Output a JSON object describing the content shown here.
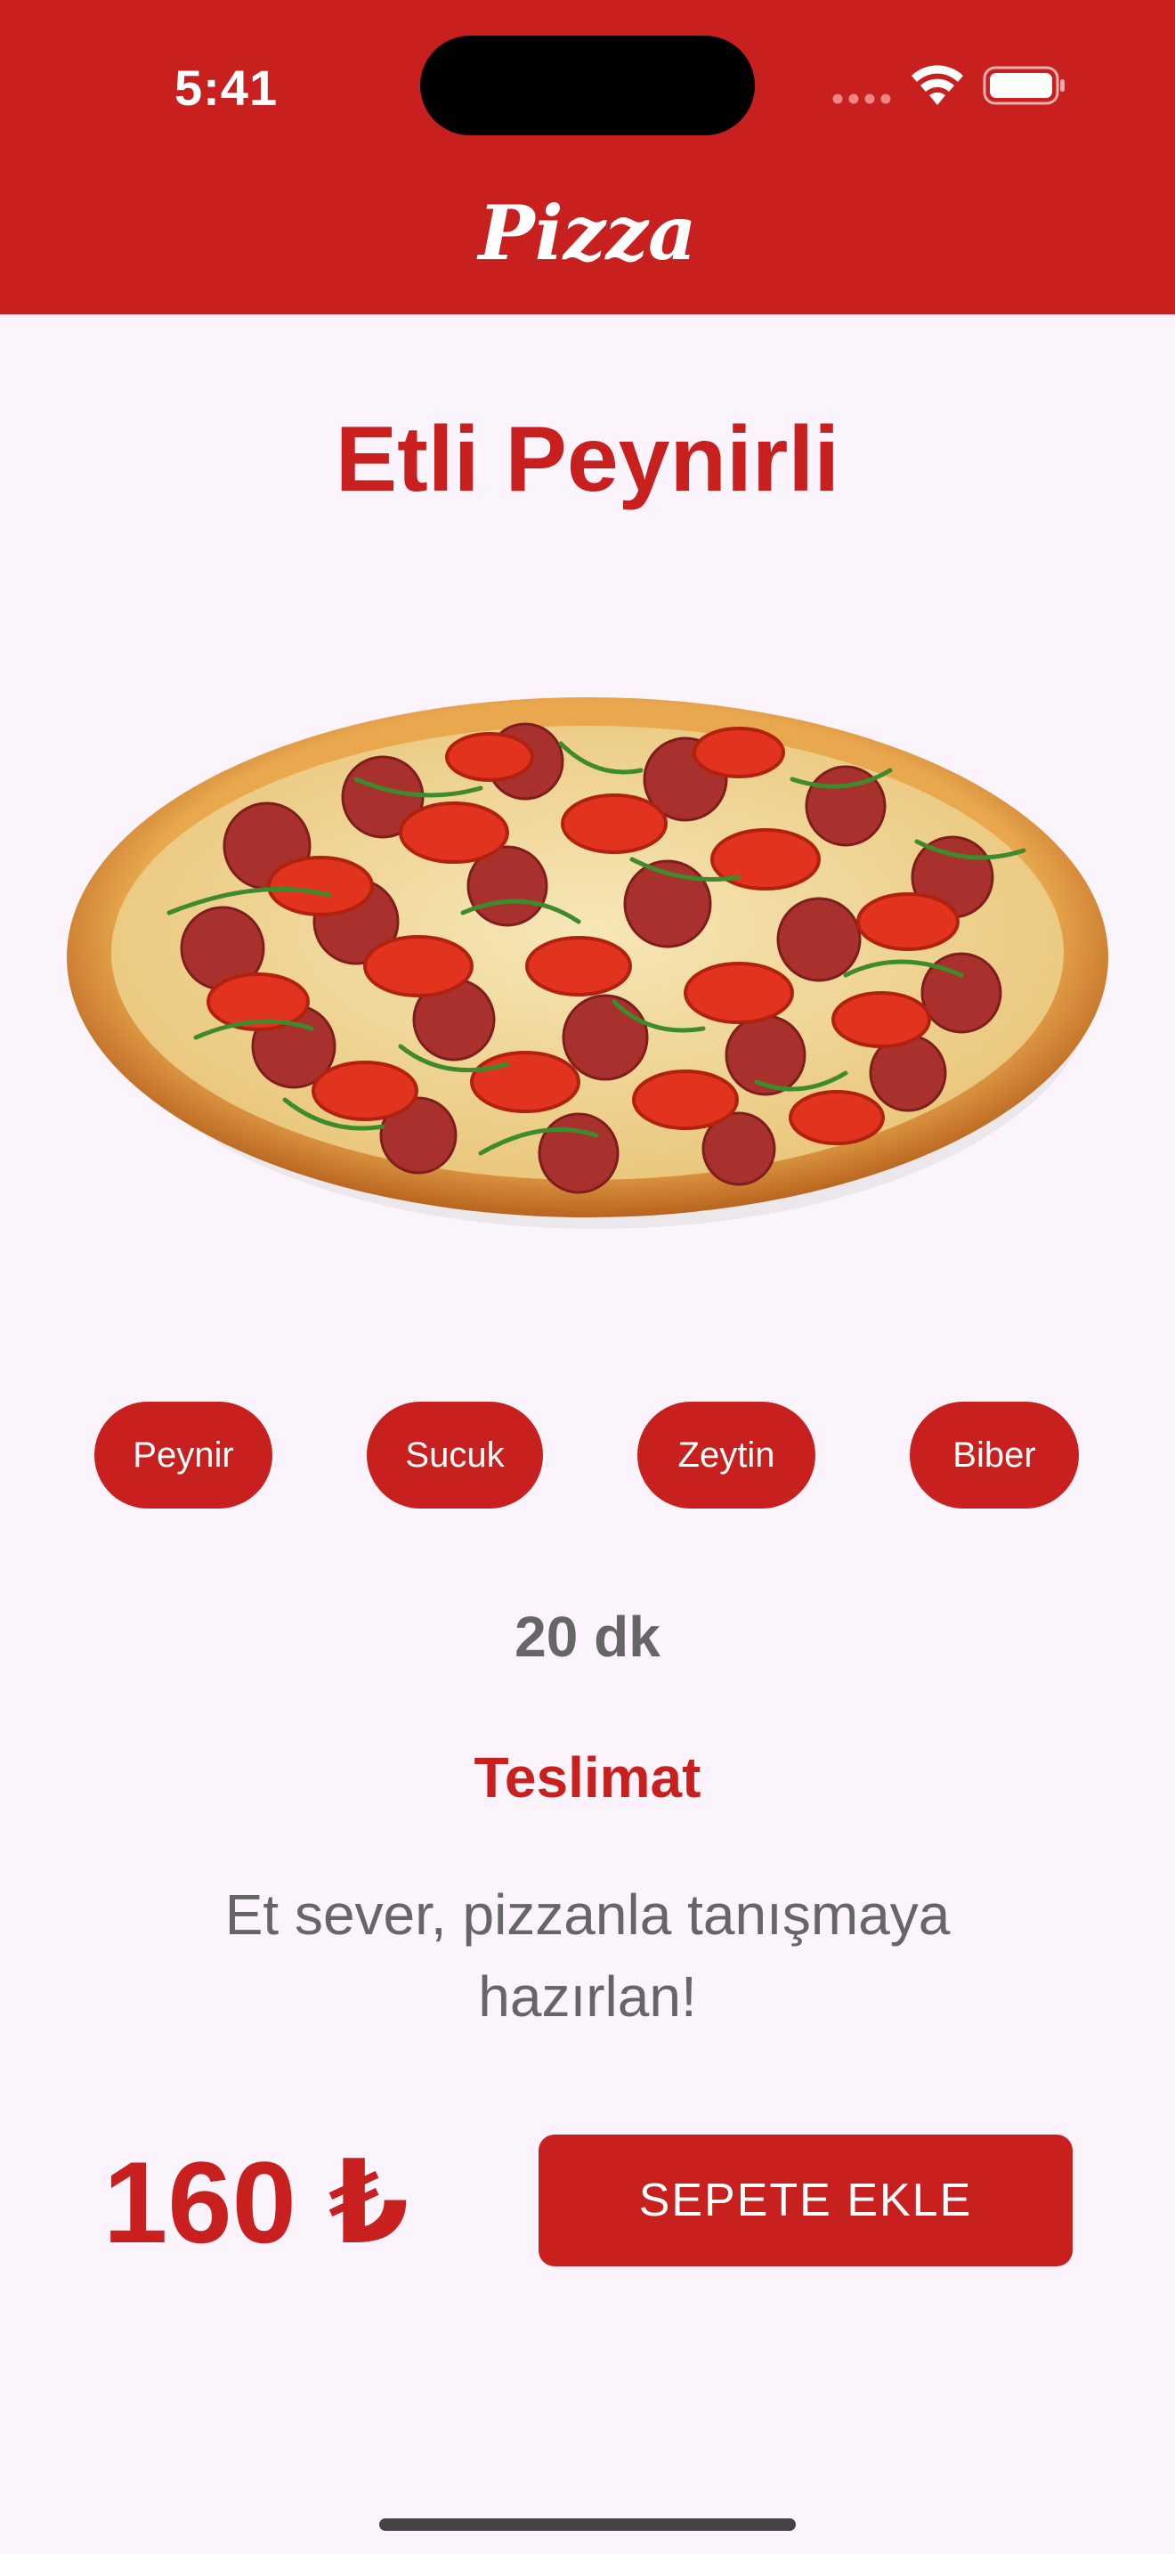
{
  "status_bar": {
    "time": "5:41",
    "icons": [
      "signal-dots-icon",
      "wifi-icon",
      "battery-icon"
    ]
  },
  "header": {
    "title": "Pizza"
  },
  "product": {
    "name": "Etli Peynirli",
    "image": "pizza-image",
    "toppings": [
      "Peynir",
      "Sucuk",
      "Zeytin",
      "Biber"
    ],
    "delivery_time": "20 dk",
    "delivery_label": "Teslimat",
    "description": "Et sever, pizzanla tanışmaya hazırlan!",
    "price": "160 ₺",
    "add_to_cart_label": "SEPETE EKLE"
  },
  "colors": {
    "accent": "#C81F1F",
    "background": "#FCF4FC",
    "muted_text": "#666666"
  }
}
